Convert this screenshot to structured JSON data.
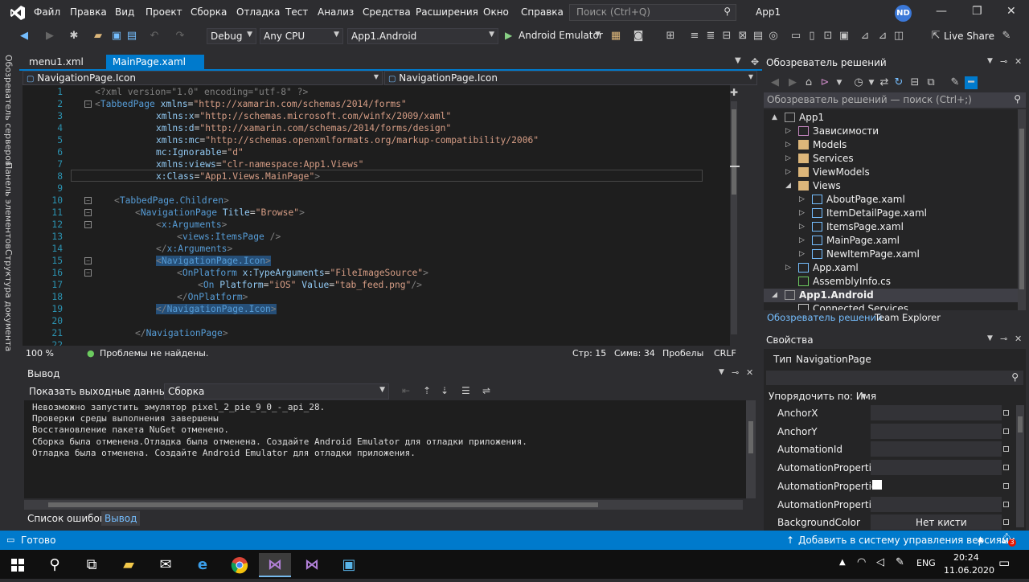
{
  "menubar": {
    "items": [
      "Файл",
      "Правка",
      "Вид",
      "Проект",
      "Сборка",
      "Отладка",
      "Тест",
      "Анализ",
      "Средства",
      "Расширения",
      "Окно",
      "Справка"
    ],
    "search_placeholder": "Поиск (Ctrl+Q)",
    "app_title": "App1",
    "avatar_initials": "ND"
  },
  "toolbar": {
    "config": "Debug",
    "platform": "Any CPU",
    "startup_project": "App1.Android",
    "run_target": "Android Emulator",
    "live_share": "Live Share"
  },
  "left_strip": {
    "tabs": [
      "Обозреватель серверов",
      "Панель элементов",
      "Структура документа"
    ]
  },
  "editor": {
    "tabs": [
      {
        "label": "menu1.xml",
        "active": false
      },
      {
        "label": "MainPage.xaml",
        "active": true
      }
    ],
    "nav_left": "NavigationPage.Icon",
    "nav_right": "NavigationPage.Icon",
    "line_numbers": [
      "1",
      "2",
      "3",
      "4",
      "5",
      "6",
      "7",
      "8",
      "9",
      "10",
      "11",
      "12",
      "13",
      "14",
      "15",
      "16",
      "17",
      "18",
      "19",
      "20",
      "21",
      "22"
    ],
    "zoom": "100 %",
    "status_msg": "Проблемы не найдены.",
    "row": "Стр: 15",
    "col": "Симв: 34",
    "spaces": "Пробелы",
    "line_ending": "CRLF"
  },
  "code": {
    "l1": "<?xml version=\"1.0\" encoding=\"utf-8\" ?>",
    "l2_tag": "TabbedPage",
    "l2_attr": "xmlns",
    "l2_val": "\"http://xamarin.com/schemas/2014/forms\"",
    "l3_attr": "xmlns:x",
    "l3_val": "\"http://schemas.microsoft.com/winfx/2009/xaml\"",
    "l4_attr": "xmlns:d",
    "l4_val": "\"http://xamarin.com/schemas/2014/forms/design\"",
    "l5_attr": "xmlns:mc",
    "l5_val": "\"http://schemas.openxmlformats.org/markup-compatibility/2006\"",
    "l6_attr": "mc:Ignorable",
    "l6_val": "\"d\"",
    "l7_attr": "xmlns:views",
    "l7_val": "\"clr-namespace:App1.Views\"",
    "l8_attr": "x:Class",
    "l8_val": "\"App1.Views.MainPage\"",
    "l10_tag": "TabbedPage.Children",
    "l11_tag": "NavigationPage",
    "l11_attr": "Title",
    "l11_val": "\"Browse\"",
    "l12_tag": "x:Arguments",
    "l13_tag": "views:ItemsPage",
    "l14_tag": "x:Arguments",
    "l15_tag": "NavigationPage.Icon",
    "l16_tag": "OnPlatform",
    "l16_attr": "x:TypeArguments",
    "l16_val": "\"FileImageSource\"",
    "l17_tag": "On",
    "l17_attr1": "Platform",
    "l17_val1": "\"iOS\"",
    "l17_attr2": "Value",
    "l17_val2": "\"tab_feed.png\"",
    "l18_tag": "OnPlatform",
    "l19_tag": "NavigationPage.Icon",
    "l21_tag": "NavigationPage"
  },
  "output": {
    "title": "Вывод",
    "show_label": "Показать выходные данные из:",
    "source": "Сборка",
    "lines": [
      "Невозможно запустить эмулятор pixel_2_pie_9_0_-_api_28.",
      "Проверки среды выполнения завершены",
      "Восстановление пакета NuGet отменено.",
      "Сборка была отменена.Отладка была отменена. Создайте Android Emulator для отладки приложения.",
      "Отладка была отменена. Создайте Android Emulator для отладки приложения."
    ],
    "tabs": [
      "Список ошибок",
      "Вывод"
    ]
  },
  "solution_explorer": {
    "title": "Обозреватель решений",
    "search_placeholder": "Обозреватель решений — поиск (Ctrl+;)",
    "items": [
      {
        "label": "App1",
        "level": 0,
        "expander": "▲",
        "bold": false
      },
      {
        "label": "Зависимости",
        "level": 1,
        "expander": "▷",
        "bold": false
      },
      {
        "label": "Models",
        "level": 1,
        "expander": "▷",
        "bold": false
      },
      {
        "label": "Services",
        "level": 1,
        "expander": "▷",
        "bold": false
      },
      {
        "label": "ViewModels",
        "level": 1,
        "expander": "▷",
        "bold": false
      },
      {
        "label": "Views",
        "level": 1,
        "expander": "◢",
        "bold": false
      },
      {
        "label": "AboutPage.xaml",
        "level": 2,
        "expander": "▷",
        "bold": false
      },
      {
        "label": "ItemDetailPage.xaml",
        "level": 2,
        "expander": "▷",
        "bold": false
      },
      {
        "label": "ItemsPage.xaml",
        "level": 2,
        "expander": "▷",
        "bold": false
      },
      {
        "label": "MainPage.xaml",
        "level": 2,
        "expander": "▷",
        "bold": false
      },
      {
        "label": "NewItemPage.xaml",
        "level": 2,
        "expander": "▷",
        "bold": false
      },
      {
        "label": "App.xaml",
        "level": 1,
        "expander": "▷",
        "bold": false
      },
      {
        "label": "AssemblyInfo.cs",
        "level": 1,
        "expander": "",
        "bold": false
      },
      {
        "label": "App1.Android",
        "level": 0,
        "expander": "◢",
        "bold": true
      },
      {
        "label": "Connected Services",
        "level": 1,
        "expander": "",
        "bold": false
      }
    ],
    "tabs": [
      "Обозреватель решений",
      "Team Explorer"
    ]
  },
  "properties": {
    "title": "Свойства",
    "type_label": "Тип",
    "type_value": "NavigationPage",
    "sort_label": "Упорядочить по: Имя",
    "rows": [
      {
        "name": "AnchorX",
        "value": ""
      },
      {
        "name": "AnchorY",
        "value": ""
      },
      {
        "name": "AutomationId",
        "value": ""
      },
      {
        "name": "AutomationPropertie",
        "value": ""
      },
      {
        "name": "AutomationPropertie",
        "value": ""
      },
      {
        "name": "AutomationPropertie",
        "value": ""
      },
      {
        "name": "BackgroundColor",
        "value": "Нет кисти"
      }
    ]
  },
  "statusbar": {
    "ready": "Готово",
    "source_control": "Добавить в систему управления версиями",
    "notifications": "3"
  },
  "taskbar": {
    "lang": "ENG",
    "time": "20:24",
    "date": "11.06.2020"
  },
  "colors": {
    "accent": "#007acc",
    "background": "#2d2d30",
    "editor_bg": "#1e1e1e"
  }
}
